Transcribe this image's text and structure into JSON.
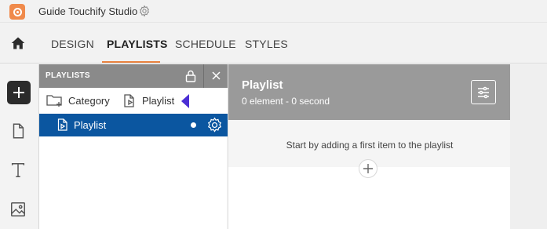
{
  "app": {
    "title": "Guide Touchify Studio"
  },
  "nav": {
    "tabs": [
      {
        "label": "DESIGN"
      },
      {
        "label": "PLAYLISTS"
      },
      {
        "label": "SCHEDULE"
      },
      {
        "label": "STYLES"
      }
    ],
    "active_tab": "PLAYLISTS"
  },
  "icons": {
    "app": "app-logo-icon",
    "title_settings": "gear-icon",
    "home": "home-icon",
    "add": "plus-icon",
    "page": "page-icon",
    "text": "text-icon",
    "image": "image-icon",
    "lock": "lock-icon",
    "close": "close-icon",
    "category": "folder-add-icon",
    "playlist": "playlist-add-icon",
    "row_settings": "gear-icon",
    "filter": "sliders-icon"
  },
  "playlists_panel": {
    "title": "PLAYLISTS",
    "toolbar": {
      "category_label": "Category",
      "playlist_label": "Playlist"
    },
    "items": [
      {
        "label": "Playlist",
        "selected": true
      }
    ]
  },
  "main": {
    "title": "Playlist",
    "subtitle": "0 element - 0 second",
    "empty_message": "Start by adding a first item to the playlist"
  },
  "colors": {
    "accent": "#e8823f",
    "selection": "#0b56a0",
    "panel_header": "#8a8a8a",
    "main_header": "#9a9a9a",
    "pointer": "#4b2fd4"
  }
}
